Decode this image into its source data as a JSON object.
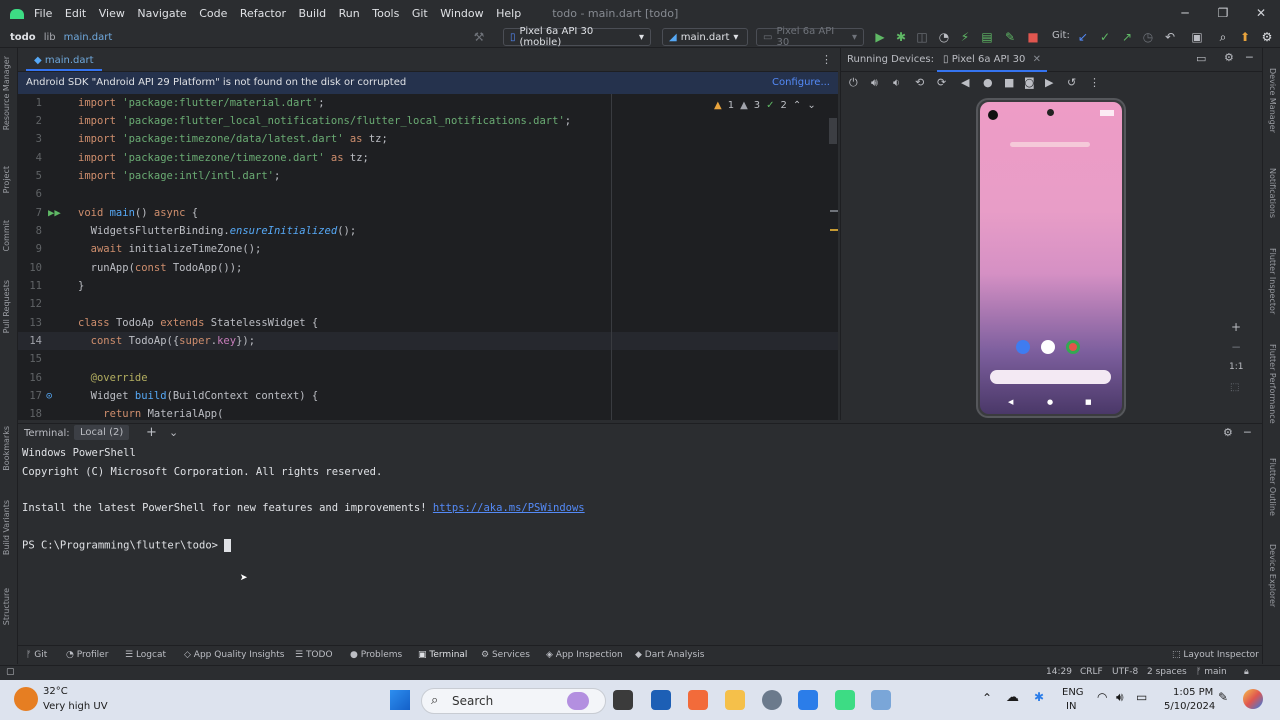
{
  "app": {
    "title": "todo - main.dart [todo]"
  },
  "menu": [
    "File",
    "Edit",
    "View",
    "Navigate",
    "Code",
    "Refactor",
    "Build",
    "Run",
    "Tools",
    "Git",
    "Window",
    "Help"
  ],
  "breadcrumb": {
    "project": "todo",
    "folder": "lib",
    "file": "main.dart"
  },
  "toolbar": {
    "device": "Pixel 6a API 30 (mobile)",
    "run_config": "main.dart",
    "device2": "Pixel 6a API 30",
    "git_label": "Git:"
  },
  "editor": {
    "tab": "main.dart",
    "notice": "Android SDK \"Android API 29 Platform\" is not found on the disk or corrupted",
    "notice_action": "Configure...",
    "warnings": "1",
    "weak_warnings": "3",
    "checks": "2",
    "line_numbers": [
      "1",
      "2",
      "3",
      "4",
      "5",
      "6",
      "7",
      "8",
      "9",
      "10",
      "11",
      "12",
      "13",
      "14",
      "15",
      "16",
      "17",
      "18"
    ]
  },
  "running_devices": {
    "title": "Running Devices:",
    "tab": "Pixel 6a API 30",
    "zoom": "1:1"
  },
  "terminal": {
    "label": "Terminal:",
    "tab": "Local (2)",
    "line1": "Windows PowerShell",
    "line2": "Copyright (C) Microsoft Corporation. All rights reserved.",
    "line3": "Install the latest PowerShell for new features and improvements! ",
    "link": "https://aka.ms/PSWindows",
    "prompt": "PS C:\\Programming\\flutter\\todo> "
  },
  "bottom_tools": [
    "Git",
    "Profiler",
    "Logcat",
    "App Quality Insights",
    "TODO",
    "Problems",
    "Terminal",
    "Services",
    "App Inspection",
    "Dart Analysis"
  ],
  "layout_inspector": "Layout Inspector",
  "status": {
    "position": "14:29",
    "line_sep": "CRLF",
    "encoding": "UTF-8",
    "indent": "2 spaces",
    "branch": "main"
  },
  "left_strip": [
    "Resource Manager",
    "Project",
    "Commit",
    "Pull Requests",
    "Bookmarks",
    "Build Variants",
    "Structure"
  ],
  "right_strip": [
    "Device Manager",
    "Notifications",
    "Flutter Inspector",
    "Flutter Performance",
    "Flutter Outline",
    "Device Explorer"
  ],
  "taskbar": {
    "temp": "32°C",
    "weather": "Very high UV",
    "search": "Search",
    "lang": "ENG",
    "region": "IN",
    "time": "1:05 PM",
    "date": "5/10/2024"
  }
}
